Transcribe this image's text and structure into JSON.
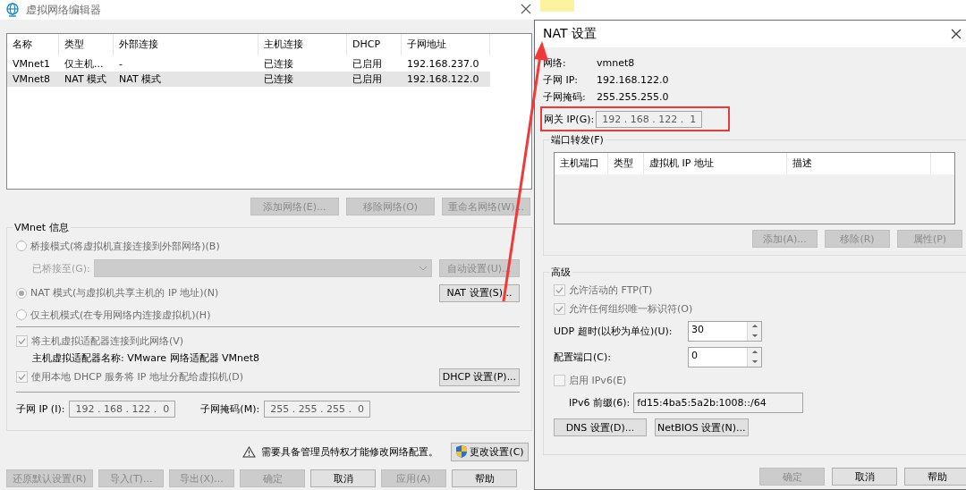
{
  "editor": {
    "title": "虚拟网络编辑器",
    "table": {
      "columns": [
        "名称",
        "类型",
        "外部连接",
        "主机连接",
        "DHCP",
        "子网地址"
      ],
      "rows": [
        {
          "cells": [
            "VMnet1",
            "仅主机...",
            "-",
            "已连接",
            "已启用",
            "192.168.237.0"
          ],
          "selected": false
        },
        {
          "cells": [
            "VMnet8",
            "NAT 模式",
            "NAT 模式",
            "已连接",
            "已启用",
            "192.168.122.0"
          ],
          "selected": true
        }
      ]
    },
    "table_buttons": [
      {
        "label": "添加网络(E)...",
        "disabled": true
      },
      {
        "label": "移除网络(O)",
        "disabled": true
      },
      {
        "label": "重命名网络(W)...",
        "disabled": true
      }
    ],
    "vmnet_info": {
      "title": "VMnet 信息",
      "modes": [
        {
          "label": "桥接模式(将虚拟机直接连接到外部网络)(B)",
          "selected": false,
          "disabled": true
        },
        {
          "label": "NAT 模式(与虚拟机共享主机的 IP 地址)(N)",
          "selected": true,
          "disabled": true
        },
        {
          "label": "仅主机模式(在专用网络内连接虚拟机)(H)",
          "selected": false,
          "disabled": true
        }
      ],
      "bridged_to": {
        "label": "已桥接至(G):",
        "disabled": true
      },
      "auto_button": {
        "label": "自动设置(U)...",
        "disabled": true
      },
      "nat_button": {
        "label": "NAT 设置(S)...",
        "disabled": false
      },
      "host_adapter": {
        "label": "将主机虚拟适配器连接到此网络(V)",
        "checked": true,
        "disabled": true
      },
      "adapter_name": "主机虚拟适配器名称: VMware 网络适配器 VMnet8",
      "dhcp": {
        "label": "使用本地 DHCP 服务将 IP 地址分配给虚拟机(D)",
        "checked": true,
        "disabled": true
      },
      "dhcp_button": {
        "label": "DHCP 设置(P)...",
        "disabled": false
      },
      "subnet_ip": {
        "label": "子网 IP (I):",
        "value": "192 . 168 . 122 .  0"
      },
      "subnet_mask": {
        "label": "子网掩码(M):",
        "value": "255 . 255 . 255 .  0"
      }
    },
    "admin_notice": "需要具备管理员特权才能修改网络配置。",
    "change_settings_button": {
      "label": "更改设置(C)",
      "disabled": false
    },
    "buttons": [
      {
        "label": "还原默认设置(R)",
        "disabled": true
      },
      {
        "label": "导入(T)...",
        "disabled": true
      },
      {
        "label": "导出(X)...",
        "disabled": true
      },
      {
        "label": "确定",
        "disabled": true
      },
      {
        "label": "取消",
        "disabled": false
      },
      {
        "label": "应用(A)",
        "disabled": true
      },
      {
        "label": "帮助",
        "disabled": false
      }
    ]
  },
  "nat": {
    "title": "NAT 设置",
    "info": [
      {
        "label": "网络:",
        "value": "vmnet8"
      },
      {
        "label": "子网 IP:",
        "value": "192.168.122.0"
      },
      {
        "label": "子网掩码:",
        "value": "255.255.255.0"
      }
    ],
    "gateway": {
      "label": "网关 IP(G):",
      "value": "192 . 168 . 122 .  1",
      "highlighted": true
    },
    "port_forwarding": {
      "title": "端口转发(F)",
      "columns": [
        "主机端口",
        "类型",
        "虚拟机 IP 地址",
        "描述"
      ],
      "buttons": [
        {
          "label": "添加(A)...",
          "disabled": true
        },
        {
          "label": "移除(R)",
          "disabled": true
        },
        {
          "label": "属性(P)",
          "disabled": true
        }
      ]
    },
    "advanced": {
      "title": "高级",
      "options": [
        {
          "label": "允许活动的 FTP(T)",
          "checked": true,
          "disabled": true
        },
        {
          "label": "允许任何组织唯一标识符(O)",
          "checked": true,
          "disabled": true
        }
      ],
      "udp_timeout": {
        "label": "UDP 超时(以秒为单位)(U):",
        "value": "30"
      },
      "config_port": {
        "label": "配置端口(C):",
        "value": "0"
      },
      "ipv6": {
        "label": "启用 IPv6(E)",
        "checked": false,
        "disabled": true
      },
      "ipv6_prefix": {
        "label": "IPv6 前缀(6):",
        "value": "fd15:4ba5:5a2b:1008::/64"
      },
      "buttons": [
        {
          "label": "DNS 设置(D)...",
          "disabled": false
        },
        {
          "label": "NetBIOS 设置(N)...",
          "disabled": false
        }
      ]
    },
    "buttons": [
      {
        "label": "确定",
        "disabled": true
      },
      {
        "label": "取消",
        "disabled": false
      },
      {
        "label": "帮助",
        "disabled": false
      }
    ]
  }
}
